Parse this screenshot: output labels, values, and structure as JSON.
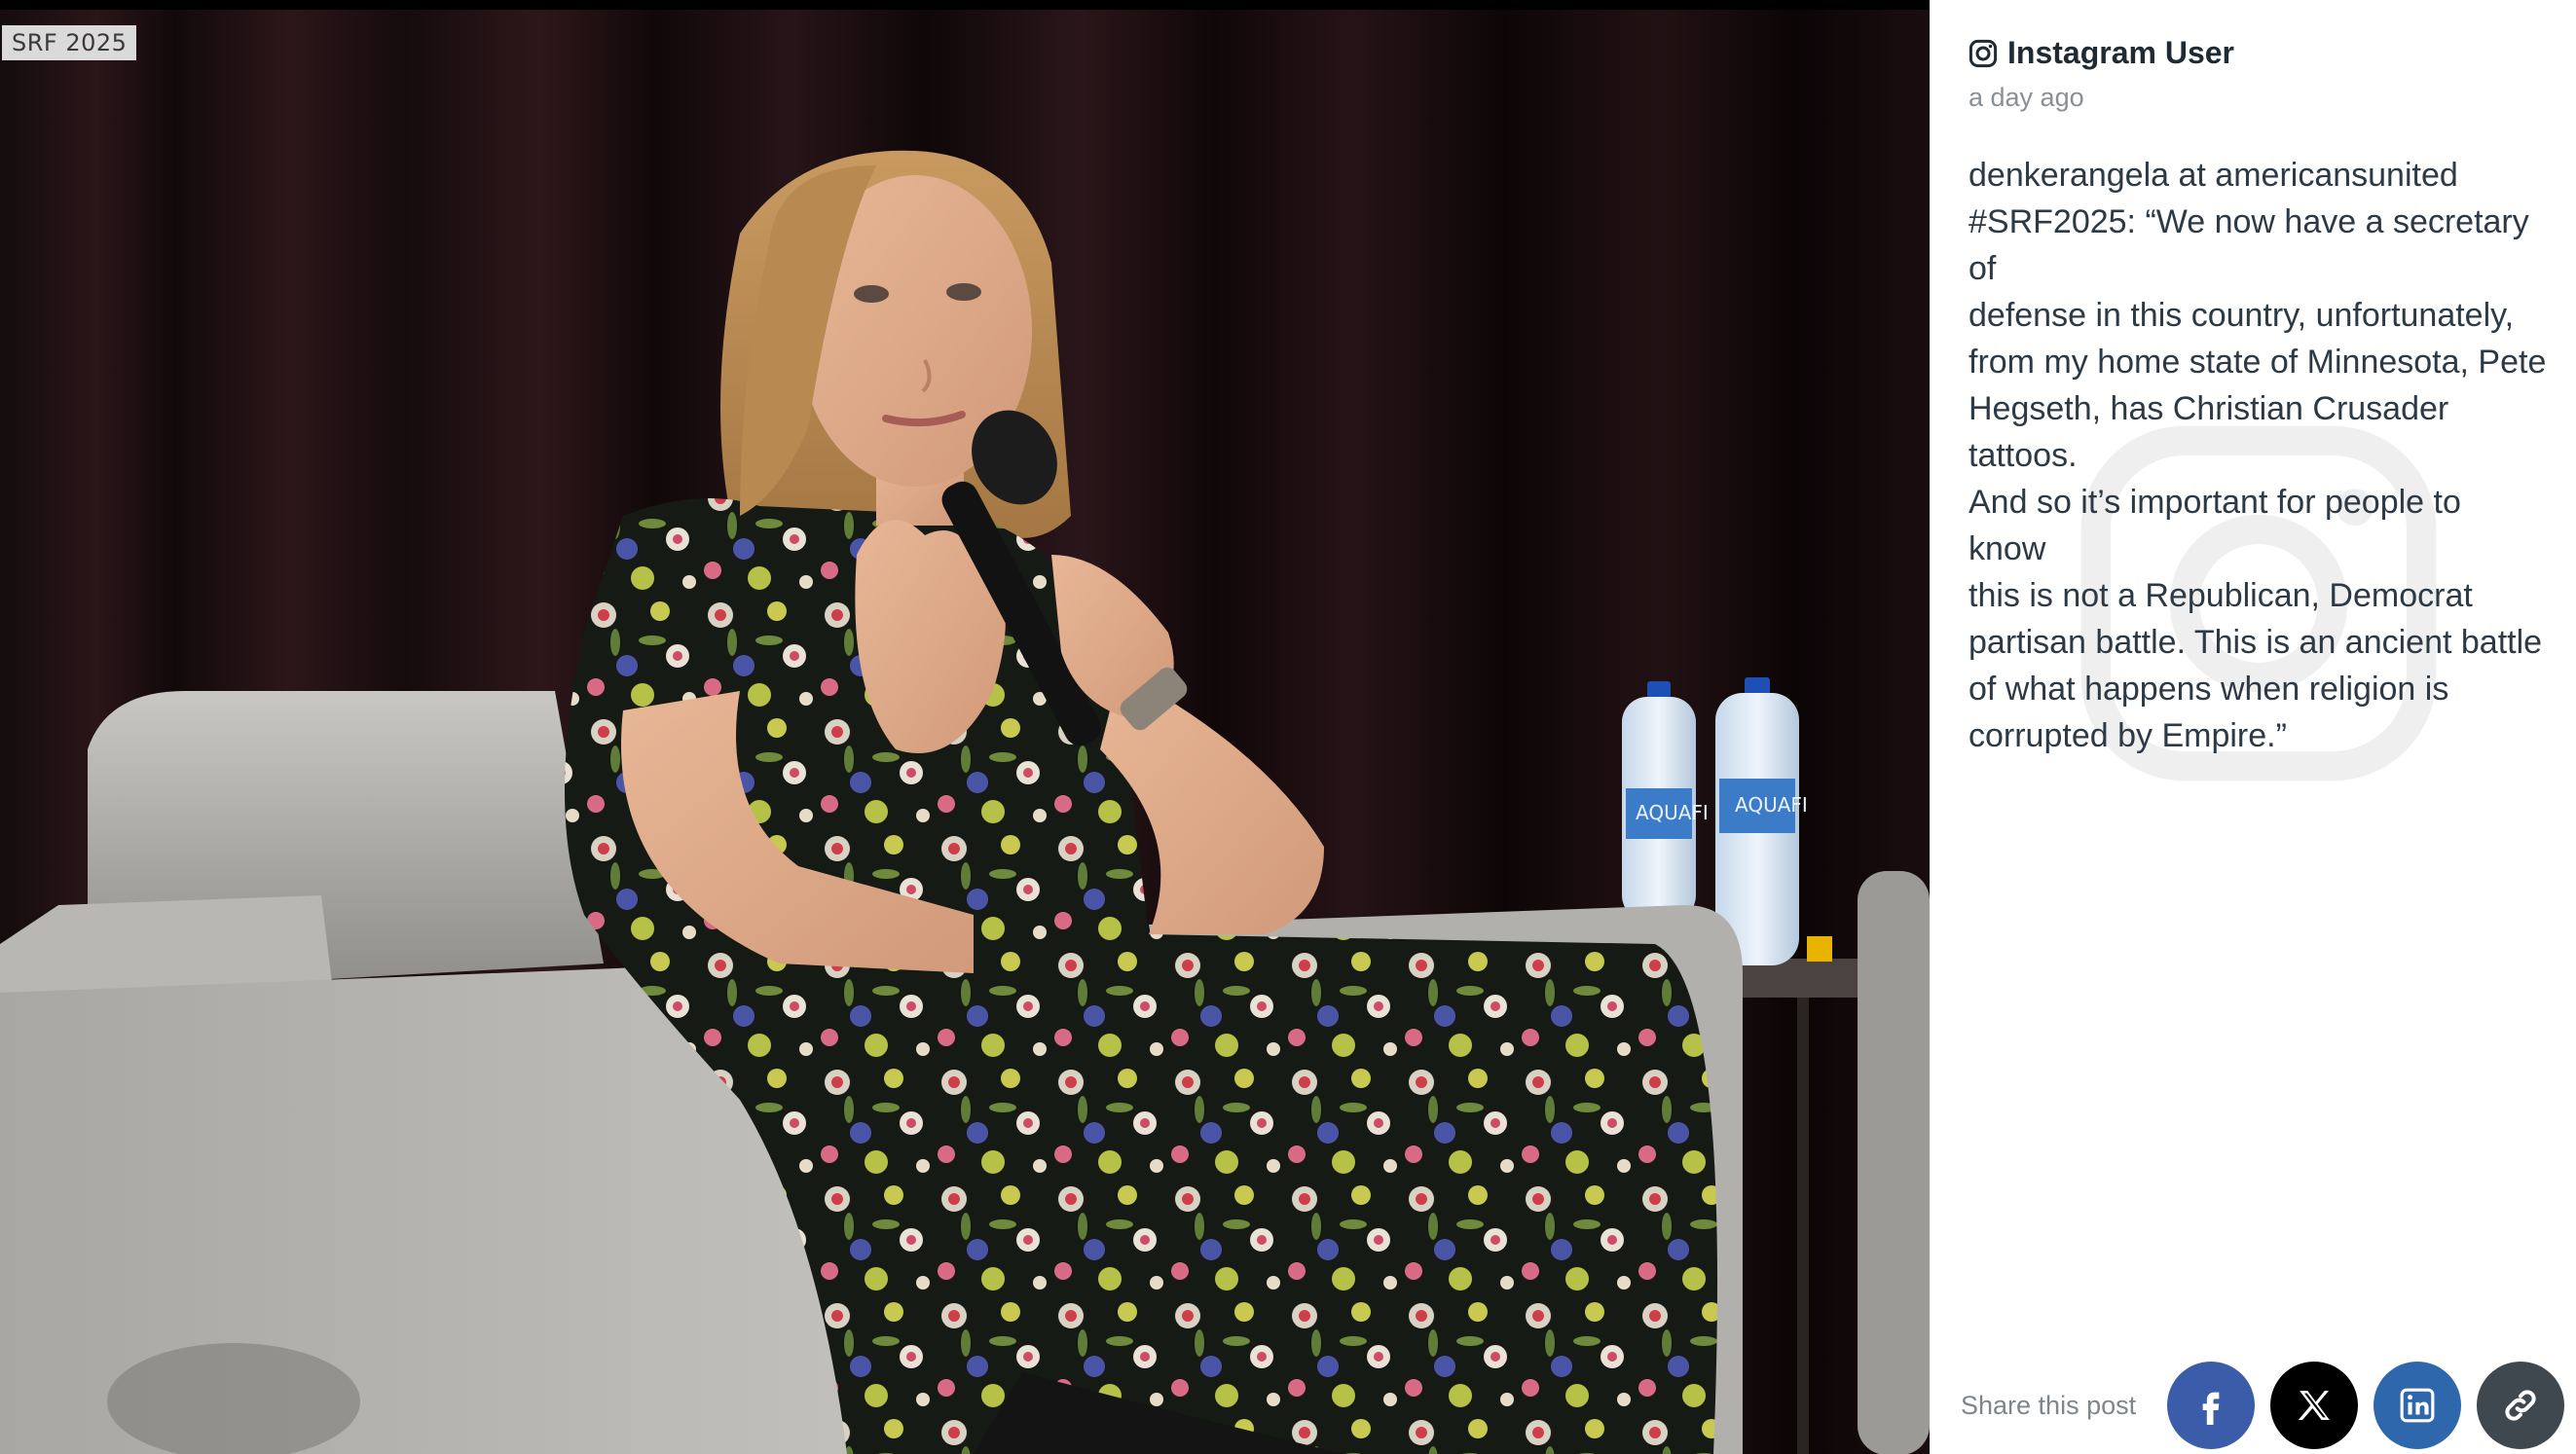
{
  "photo": {
    "overlay_label": "SRF 2025",
    "bottle_label": "AQUAFI"
  },
  "post": {
    "platform_icon": "instagram-icon",
    "author": "Instagram User",
    "timestamp": "a day ago",
    "body": "denkerangela at americansunited\n#SRF2025: “We now have a secretary of\ndefense in this country, unfortunately,\nfrom my home state of Minnesota, Pete\nHegseth, has Christian Crusader tattoos.\nAnd so it’s important for people to know\nthis is not a Republican, Democrat\npartisan battle. This is an ancient battle\nof what happens when religion is\ncorrupted by Empire.”"
  },
  "share": {
    "label": "Share this post",
    "buttons": [
      {
        "name": "facebook",
        "icon": "facebook-icon",
        "color": "#3b5ca8"
      },
      {
        "name": "x",
        "icon": "x-icon",
        "color": "#000000"
      },
      {
        "name": "linkedin",
        "icon": "linkedin-icon",
        "color": "#2f67ad"
      },
      {
        "name": "copy-link",
        "icon": "link-icon",
        "color": "#3f474f"
      }
    ]
  }
}
